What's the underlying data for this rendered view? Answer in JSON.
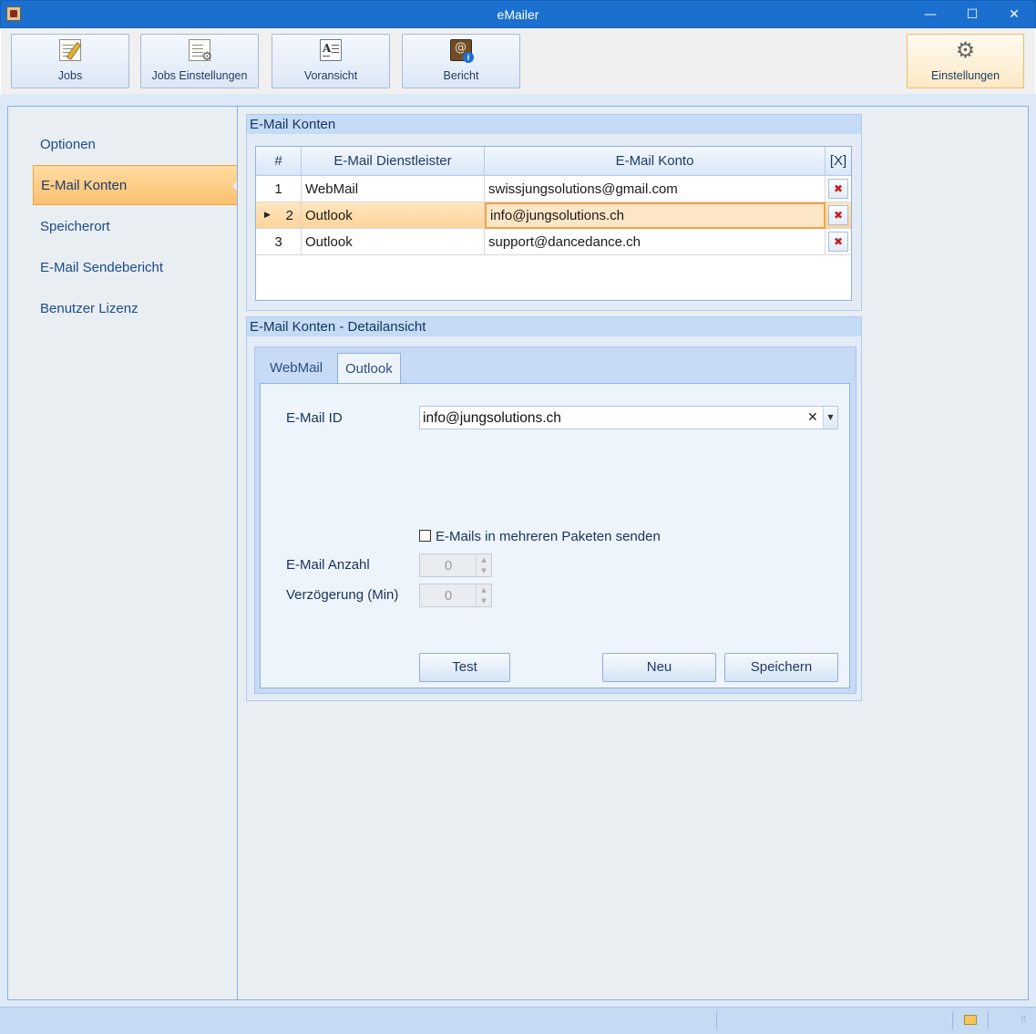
{
  "window": {
    "title": "eMailer",
    "minimize_glyph": "—",
    "maximize_glyph": "☐",
    "close_glyph": "✕"
  },
  "toolbar": {
    "buttons": [
      {
        "label": "Jobs",
        "icon": "edit-document-icon"
      },
      {
        "label": "Jobs Einstellungen",
        "icon": "document-settings-icon"
      },
      {
        "label": "Voransicht",
        "icon": "preview-icon"
      },
      {
        "label": "Bericht",
        "icon": "report-info-icon"
      }
    ],
    "settings": {
      "label": "Einstellungen",
      "icon": "gear-icon"
    }
  },
  "sidebar": {
    "items": [
      {
        "label": "Optionen"
      },
      {
        "label": "E-Mail Konten",
        "active": true
      },
      {
        "label": "Speicherort"
      },
      {
        "label": "E-Mail Sendebericht"
      },
      {
        "label": "Benutzer Lizenz"
      }
    ]
  },
  "accounts": {
    "header": "E-Mail Konten",
    "columns": [
      "#",
      "E-Mail Dienstleister",
      "E-Mail Konto",
      "[X]"
    ],
    "rows": [
      {
        "num": "1",
        "provider": "WebMail",
        "account": "swissjungsolutions@gmail.com"
      },
      {
        "num": "2",
        "provider": "Outlook",
        "account": "info@jungsolutions.ch",
        "selected": true
      },
      {
        "num": "3",
        "provider": "Outlook",
        "account": "support@dancedance.ch"
      }
    ],
    "delete_glyph": "✖",
    "row_pointer_glyph": "▶"
  },
  "detail": {
    "header": "E-Mail Konten - Detailansicht",
    "tabs": [
      {
        "label": "WebMail"
      },
      {
        "label": "Outlook",
        "active": true
      }
    ],
    "email_id_label": "E-Mail ID",
    "email_id_value": "info@jungsolutions.ch",
    "clear_glyph": "✕",
    "dropdown_glyph": "▼",
    "packages_checkbox_label": "E-Mails in mehreren Paketen senden",
    "packages_checked": false,
    "count_label": "E-Mail Anzahl",
    "count_value": "0",
    "delay_label": "Verzögerung (Min)",
    "delay_value": "0",
    "spin_up": "▲",
    "spin_down": "▼",
    "buttons": {
      "test": "Test",
      "new": "Neu",
      "save": "Speichern"
    }
  },
  "colors": {
    "titlebar": "#1a6fcf",
    "accent_selected": "#fbc070",
    "delete": "#c81e1e"
  }
}
